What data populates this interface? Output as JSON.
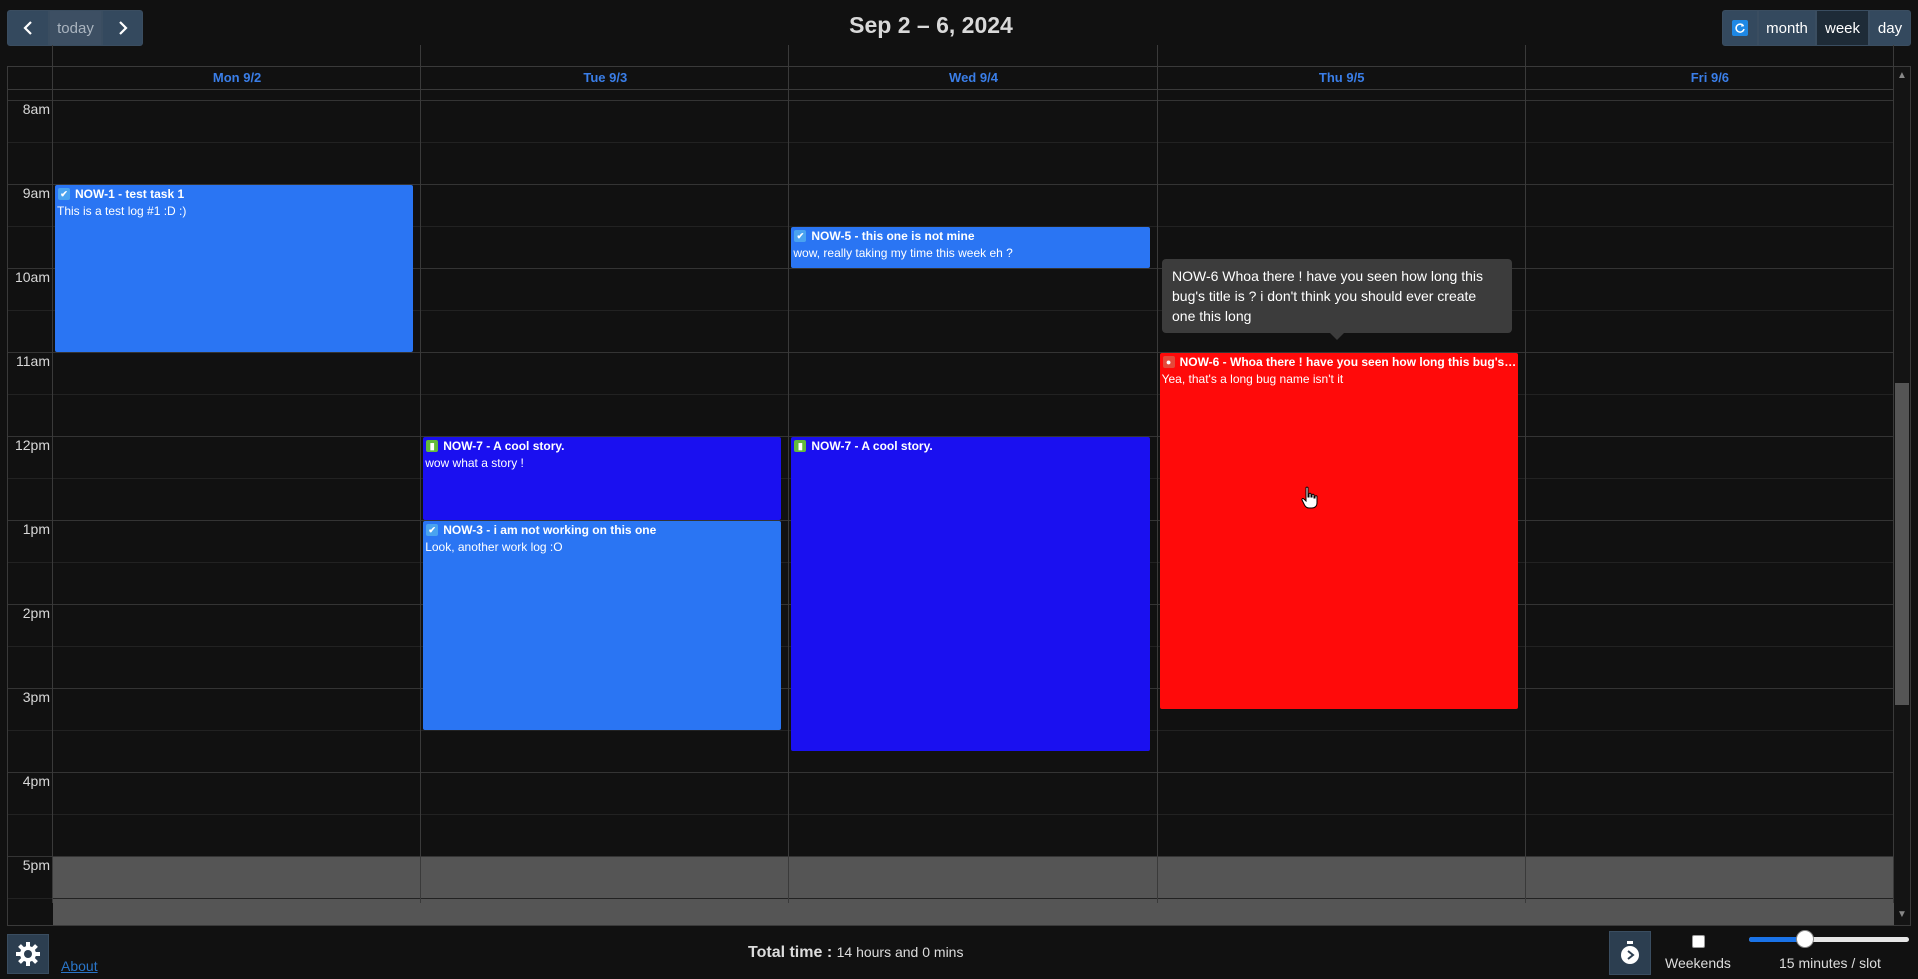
{
  "toolbar": {
    "prev_icon": "chevron-left-icon",
    "today_label": "today",
    "next_icon": "chevron-right-icon",
    "title": "Sep 2 – 6, 2024",
    "refresh_icon": "refresh-icon",
    "month_label": "month",
    "week_label": "week",
    "day_label": "day",
    "active_view": "week"
  },
  "calendar": {
    "days": [
      "Mon 9/2",
      "Tue 9/3",
      "Wed 9/4",
      "Thu 9/5",
      "Fri 9/6"
    ],
    "hours": [
      "8am",
      "9am",
      "10am",
      "11am",
      "12pm",
      "1pm",
      "2pm",
      "3pm",
      "4pm",
      "5pm"
    ],
    "events": [
      {
        "key": "NOW-1",
        "title": "NOW-1 - test task 1",
        "desc": "This is a test log #1 :D :)",
        "day": 0,
        "start": "9:00",
        "end": "11:00",
        "type": "task",
        "color": "#2a75f3"
      },
      {
        "key": "NOW-5",
        "title": "NOW-5 - this one is not mine",
        "desc": "wow, really taking my time this week eh ?",
        "day": 2,
        "start": "9:30",
        "end": "10:00",
        "type": "task",
        "color": "#2a75f3"
      },
      {
        "key": "NOW-6",
        "title": "NOW-6 - Whoa there ! have you seen how long this bug's title is ? i don't think you should ever create one this long",
        "desc": "Yea, that's a long bug name isn't it",
        "day": 3,
        "start": "11:00",
        "end": "15:15",
        "type": "bug",
        "color": "#ff0a0a"
      },
      {
        "key": "NOW-7",
        "title": "NOW-7 - A cool story.",
        "desc": "wow what a story !",
        "day": 1,
        "start": "12:00",
        "end": "13:00",
        "type": "story",
        "color": "#1a10f0"
      },
      {
        "key": "NOW-7",
        "title": "NOW-7 - A cool story.",
        "desc": "",
        "day": 2,
        "start": "12:00",
        "end": "15:45",
        "type": "story",
        "color": "#1a10f0"
      },
      {
        "key": "NOW-3",
        "title": "NOW-3 - i am not working on this one",
        "desc": "Look, another work log :O",
        "day": 1,
        "start": "13:00",
        "end": "15:30",
        "type": "task",
        "color": "#2a75f3"
      }
    ],
    "tooltip": "NOW-6 Whoa there ! have you seen how long this bug's title is ? i don't think you should ever create one this long",
    "off_hours_from": "5pm"
  },
  "footer": {
    "settings_icon": "gear-icon",
    "about_label": "About",
    "total_label": "Total time :",
    "total_value": "14 hours and 0 mins",
    "timer_icon": "stopwatch-icon",
    "weekends_label": "Weekends",
    "weekends_checked": false,
    "slot_label": "15 minutes / slot",
    "slot_slider_fraction": 0.35
  },
  "colors": {
    "task": "#2a75f3",
    "story": "#1a10f0",
    "bug": "#ff0a0a",
    "header_text": "#3a7ee8",
    "background": "#111111"
  }
}
